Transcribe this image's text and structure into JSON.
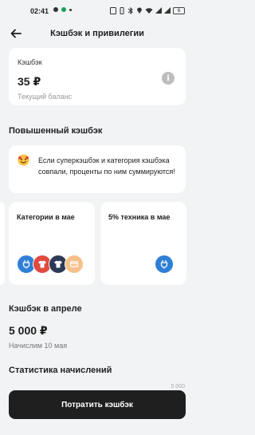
{
  "status_bar": {
    "time": "02:41",
    "battery": "6"
  },
  "header": {
    "title": "Кэшбэк и привилегии"
  },
  "balance": {
    "label": "Кэшбэк",
    "amount": "35 ₽",
    "sublabel": "Текущий баланс"
  },
  "boosted": {
    "title": "Повышенный кэшбэк",
    "promo_text": "Если суперкэшбэк и категория кэшбэка совпали, проценты по ним суммируются!"
  },
  "categories": [
    {
      "title": "Категории в мае",
      "icons": [
        {
          "name": "plug-icon",
          "color": "#2f7fd6"
        },
        {
          "name": "shirt-icon",
          "color": "#e04a3f"
        },
        {
          "name": "shirt-icon",
          "color": "#2b3a55"
        },
        {
          "name": "card-icon",
          "color": "#f6c08a"
        }
      ]
    },
    {
      "title": "5% техника в мае",
      "icons": [
        {
          "name": "plug-icon",
          "color": "#2f7fd6"
        }
      ]
    }
  ],
  "april": {
    "title": "Кэшбэк в апреле",
    "amount": "5 000 ₽",
    "sublabel": "Начислим 10 мая"
  },
  "stats": {
    "title": "Статистика начислений",
    "tick": "5 000"
  },
  "actions": {
    "spend_label": "Потратить кэшбэк"
  },
  "colors": {
    "background": "#f2f3f5",
    "button": "#1f1f1f"
  }
}
